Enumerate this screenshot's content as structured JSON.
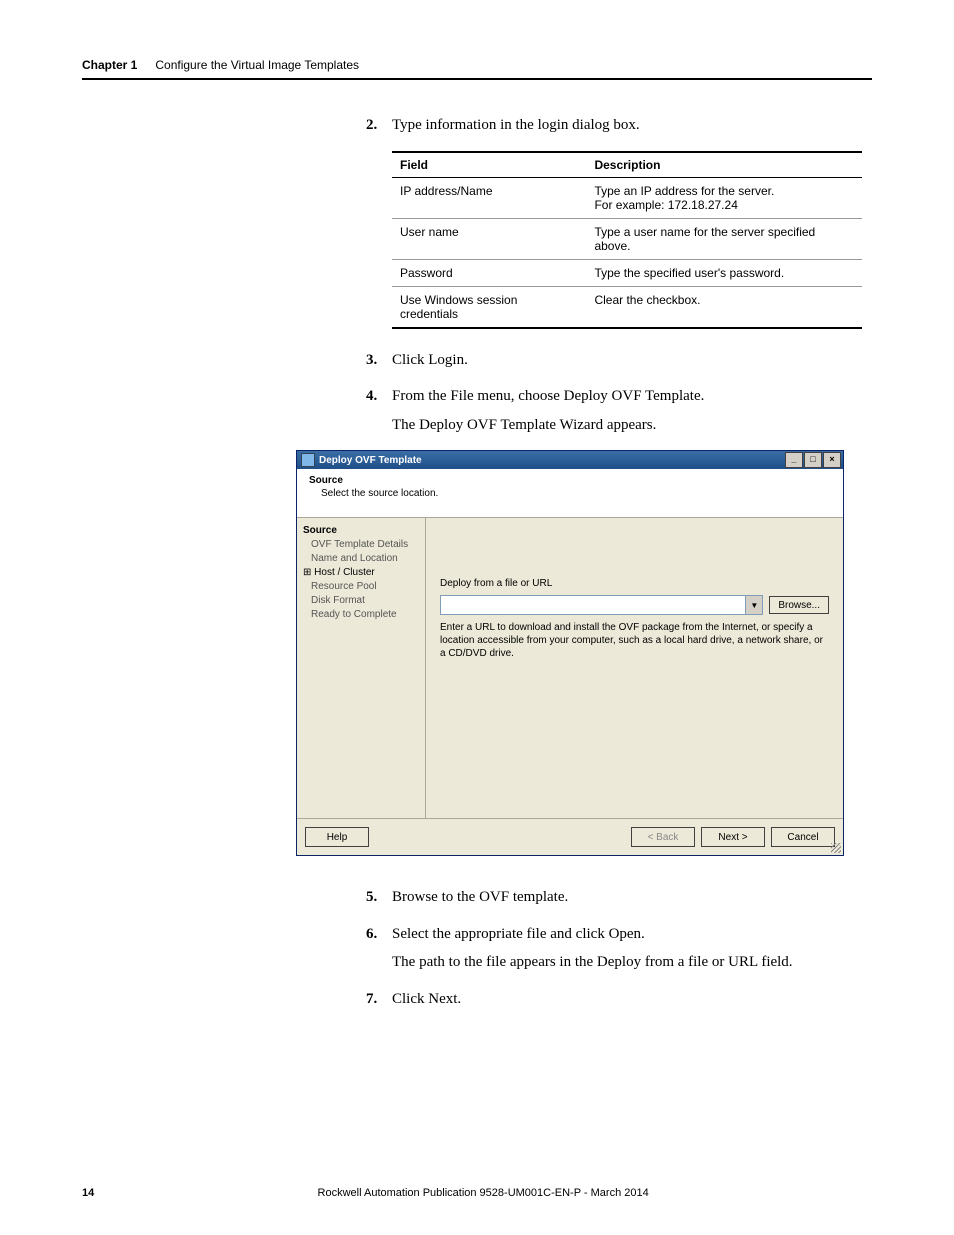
{
  "header": {
    "chapter": "Chapter 1",
    "title": "Configure the Virtual Image Templates"
  },
  "steps": {
    "s2": {
      "num": "2.",
      "text": "Type information in the login dialog box."
    },
    "s3": {
      "num": "3.",
      "text": "Click Login."
    },
    "s4": {
      "num": "4.",
      "text": "From the File menu, choose Deploy OVF Template.",
      "follow": "The Deploy OVF Template Wizard appears."
    },
    "s5": {
      "num": "5.",
      "text": "Browse to the OVF template."
    },
    "s6": {
      "num": "6.",
      "text": "Select the appropriate file and click Open.",
      "follow": "The path to the file appears in the Deploy from a file or URL field."
    },
    "s7": {
      "num": "7.",
      "text": "Click Next."
    }
  },
  "table": {
    "head": {
      "field": "Field",
      "desc": "Description"
    },
    "rows": [
      {
        "field": "IP address/Name",
        "desc": "Type an IP address for the server.\nFor example: 172.18.27.24"
      },
      {
        "field": "User name",
        "desc": "Type a user name for the server specified above."
      },
      {
        "field": "Password",
        "desc": "Type the specified user's password."
      },
      {
        "field": "Use Windows session credentials",
        "desc": "Clear the checkbox."
      }
    ]
  },
  "dialog": {
    "title": "Deploy OVF Template",
    "headTitle": "Source",
    "headSub": "Select the source location.",
    "nav": {
      "n0": "Source",
      "n1": "OVF Template Details",
      "n2": "Name and Location",
      "n3": "Host / Cluster",
      "n3prefix": "⊞",
      "n4": "Resource Pool",
      "n5": "Disk Format",
      "n6": "Ready to Complete"
    },
    "mainLabel": "Deploy from a file or URL",
    "browse": "Browse...",
    "dropdown_glyph": "▼",
    "hint": "Enter a URL to download and install the OVF package from the Internet, or specify a location accessible from your computer, such as a local hard drive, a network share, or a CD/DVD drive.",
    "help": "Help",
    "back": "< Back",
    "next": "Next >",
    "cancel": "Cancel",
    "winbtns": {
      "min": "_",
      "max": "□",
      "close": "×"
    }
  },
  "footer": {
    "page": "14",
    "pub": "Rockwell Automation Publication 9528-UM001C-EN-P - March 2014"
  }
}
